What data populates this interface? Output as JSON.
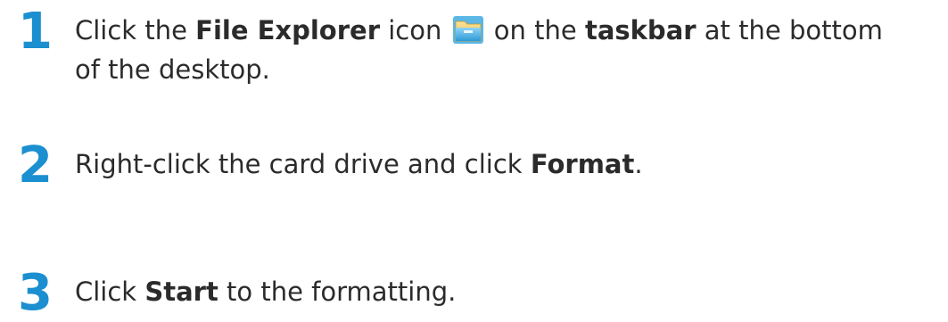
{
  "steps": [
    {
      "number": "1",
      "line1_pre": "Click the ",
      "line1_bold1": "File Explorer",
      "line1_mid": " icon ",
      "line1_post": " on the ",
      "line1_bold2": "taskbar",
      "line1_end": " at the bottom",
      "line2": "of the desktop.",
      "icon": "file-explorer-icon"
    },
    {
      "number": "2",
      "pre": "Right-click the card drive and click ",
      "bold": "Format",
      "post": "."
    },
    {
      "number": "3",
      "pre": "Click ",
      "bold": "Start",
      "post": " to the formatting."
    }
  ],
  "colors": {
    "accent": "#1b8fd0",
    "text": "#2b2b2b"
  }
}
